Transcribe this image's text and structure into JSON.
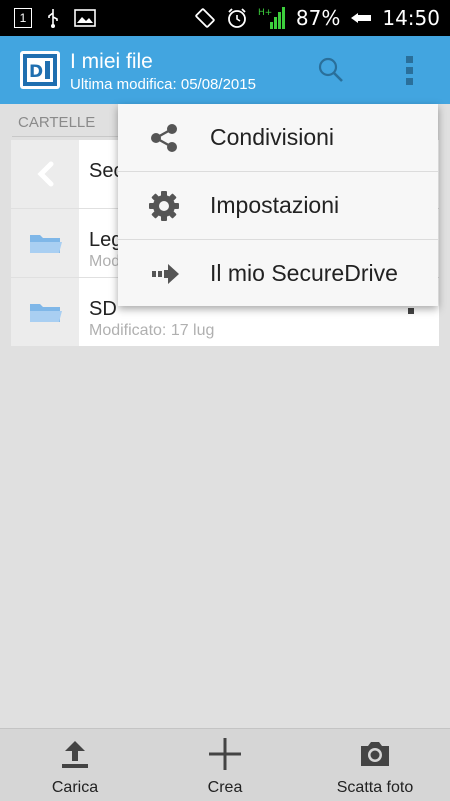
{
  "status_bar": {
    "sim_badge": "1",
    "battery": "87%",
    "time": "14:50"
  },
  "action_bar": {
    "title": "I miei file",
    "subtitle": "Ultima modifica: 05/08/2015",
    "background": "#42a5e0"
  },
  "section": {
    "header": "CARTELLE"
  },
  "list": {
    "rows": [
      {
        "name": "Sec",
        "meta": "",
        "icon": "back-chevron-icon"
      },
      {
        "name": "Leg",
        "meta": "Mod",
        "icon": "folder-icon"
      },
      {
        "name": "SD",
        "meta": "Modificato: 17 lug",
        "icon": "folder-icon"
      }
    ]
  },
  "menu": {
    "items": [
      {
        "label": "Condivisioni",
        "icon": "share-icon"
      },
      {
        "label": "Impostazioni",
        "icon": "gear-icon"
      },
      {
        "label": "Il mio SecureDrive",
        "icon": "arrow-right-icon"
      }
    ]
  },
  "bottom_bar": {
    "buttons": [
      {
        "label": "Carica",
        "icon": "upload-icon"
      },
      {
        "label": "Crea",
        "icon": "plus-icon"
      },
      {
        "label": "Scatta foto",
        "icon": "camera-icon"
      }
    ]
  }
}
